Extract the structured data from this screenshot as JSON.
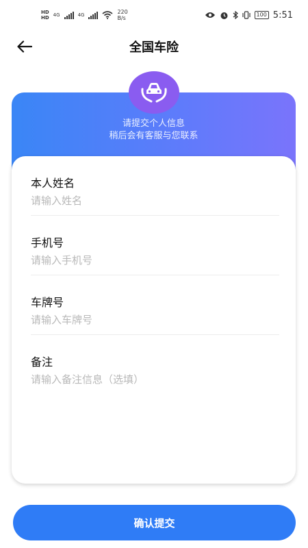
{
  "status_bar": {
    "hd_top": "HD",
    "hd_bottom": "HD",
    "sim1": "4G",
    "sim2": "4G",
    "speed_value": "220",
    "speed_unit": "B/s",
    "battery": "100",
    "time": "5:51"
  },
  "header": {
    "title": "全国车险"
  },
  "intro": {
    "line1": "请提交个人信息",
    "line2": "稍后会有客服与您联系"
  },
  "form": {
    "fields": [
      {
        "label": "本人姓名",
        "placeholder": "请输入姓名",
        "value": ""
      },
      {
        "label": "手机号",
        "placeholder": "请输入手机号",
        "value": ""
      },
      {
        "label": "车牌号",
        "placeholder": "请输入车牌号",
        "value": ""
      },
      {
        "label": "备注",
        "placeholder": "请输入备注信息（选填）",
        "value": ""
      }
    ]
  },
  "submit": {
    "label": "确认提交"
  },
  "colors": {
    "accent": "#2f7cf6",
    "badge": "#8a5cf0"
  }
}
